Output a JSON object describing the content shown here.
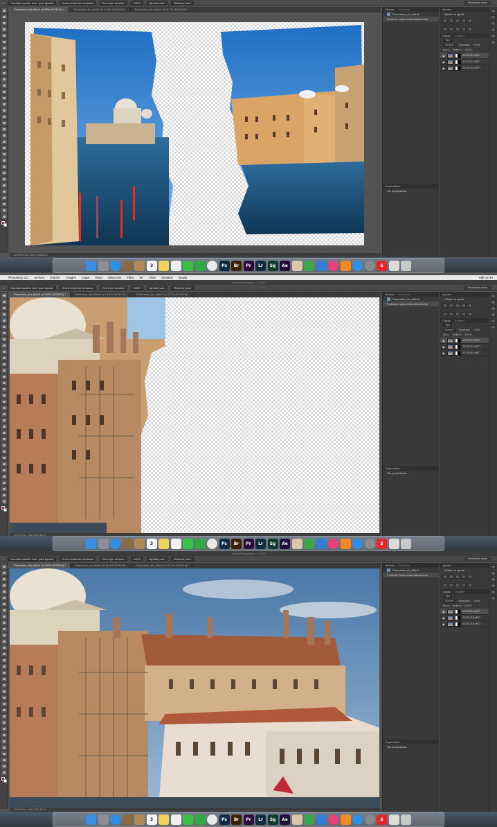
{
  "menu": {
    "items": [
      "Photoshop CC",
      "Archivo",
      "Edición",
      "Imagen",
      "Capa",
      "Texto",
      "Selección",
      "Filtro",
      "3D",
      "Vista",
      "Ventana",
      "Ayuda"
    ],
    "clock": "Mié 12:40"
  },
  "app_title": "Adobe Photoshop CC 2015",
  "options": {
    "resize_all": "Cambiar tamaño vent. para ajustar",
    "zoom_all": "Zoom todas las ventanas",
    "scrubby": "Zoom por arrastre",
    "zoom_pct": "100%",
    "fit": "Ajustar pant.",
    "fill": "Rellenar pant.",
    "workspace": "Panorama stars"
  },
  "screens": [
    {
      "tabs": [
        "Panorama_sin_titulo1 al 18% (RGB/16) *",
        "Panorama_sin_titulo2 al 34,6% (RGB/16) *",
        "Panorama_sin_titulo3 al 16,7% (RGB/16) *"
      ],
      "status": "33,33%    Doc: 194,7 M/1,62 G"
    },
    {
      "tabs": [
        "Panorama_sin_titulo1 al 100% (RGB/16) *",
        "Panorama_sin_titulo2 al 34,6% (RGB/16) *",
        "Panorama_sin_titulo3 al 16,7% (RGB/16) *"
      ],
      "status": "100%    Doc: 194,7 M/1,62 G"
    },
    {
      "tabs": [
        "Panorama_sin_titulo1 al 100% (RGB/16) *",
        "Panorama_sin_titulo2 al 34,6% (RGB/16) *",
        "Panorama_sin_titulo3 al 16,7% (RGB/16) *"
      ],
      "status": "100%    Doc: 194,7 M/1,62 G"
    }
  ],
  "history": {
    "title": "Historia",
    "title2": "Acciones",
    "items": [
      "Panorama_sin_titulo1",
      "Fusionar capas automáticamente"
    ]
  },
  "adjust": {
    "title": "Ajustes",
    "subtitle": "Añadir un ajuste"
  },
  "layers": {
    "title": "Capas",
    "title2": "Canales",
    "kind": "Tipo",
    "mode": "Normal",
    "opacity_label": "Opacidad:",
    "opacity": "100%",
    "lock_label": "Bloq.:",
    "fill_label": "Relleno:",
    "fill": "100%",
    "items": [
      "20151218-MET",
      "20151218-MET",
      "20151218-MET"
    ]
  },
  "properties": {
    "title": "Propiedades",
    "empty": "Sin propiedades"
  },
  "dock": [
    {
      "name": "finder",
      "label": "",
      "color": "#3b8ee0"
    },
    {
      "name": "launchpad",
      "label": "",
      "color": "#8d8d99"
    },
    {
      "name": "safari",
      "label": "",
      "color": "#2f8ee6"
    },
    {
      "name": "mail",
      "label": "",
      "color": "#8b6a3e"
    },
    {
      "name": "contacts",
      "label": "",
      "color": "#b08a5a"
    },
    {
      "name": "calendar",
      "label": "3",
      "color": "#f4f4f4"
    },
    {
      "name": "notes",
      "label": "",
      "color": "#f2d35a"
    },
    {
      "name": "reminders",
      "label": "",
      "color": "#f0f0f0"
    },
    {
      "name": "messages",
      "label": "",
      "color": "#3bbf4a"
    },
    {
      "name": "facetime",
      "label": "",
      "color": "#33a845"
    },
    {
      "name": "photos",
      "label": "",
      "color": "#e9e9e9"
    },
    {
      "name": "photoshop",
      "label": "Ps",
      "color": "#0d2b45"
    },
    {
      "name": "bridge",
      "label": "Br",
      "color": "#3a2200"
    },
    {
      "name": "premiere",
      "label": "Pr",
      "color": "#2a0d3a"
    },
    {
      "name": "lightroom",
      "label": "Lr",
      "color": "#122a3e"
    },
    {
      "name": "speedgrade",
      "label": "Sg",
      "color": "#0f3a2e"
    },
    {
      "name": "after-effects",
      "label": "Ae",
      "color": "#1e0d3a"
    },
    {
      "name": "preview",
      "label": "",
      "color": "#d9c9a8"
    },
    {
      "name": "numbers",
      "label": "",
      "color": "#3aa84a"
    },
    {
      "name": "keynote",
      "label": "",
      "color": "#2f7fd8"
    },
    {
      "name": "itunes",
      "label": "",
      "color": "#e7407a"
    },
    {
      "name": "ibooks",
      "label": "",
      "color": "#f08a24"
    },
    {
      "name": "app-store",
      "label": "",
      "color": "#2f8ee6"
    },
    {
      "name": "system-prefs",
      "label": "",
      "color": "#8a8a8a"
    },
    {
      "name": "skitch",
      "label": "S",
      "color": "#e3262e"
    },
    {
      "name": "documents",
      "label": "",
      "color": "#dcdcdc"
    },
    {
      "name": "trash",
      "label": "",
      "color": "#c8c8c8"
    }
  ]
}
